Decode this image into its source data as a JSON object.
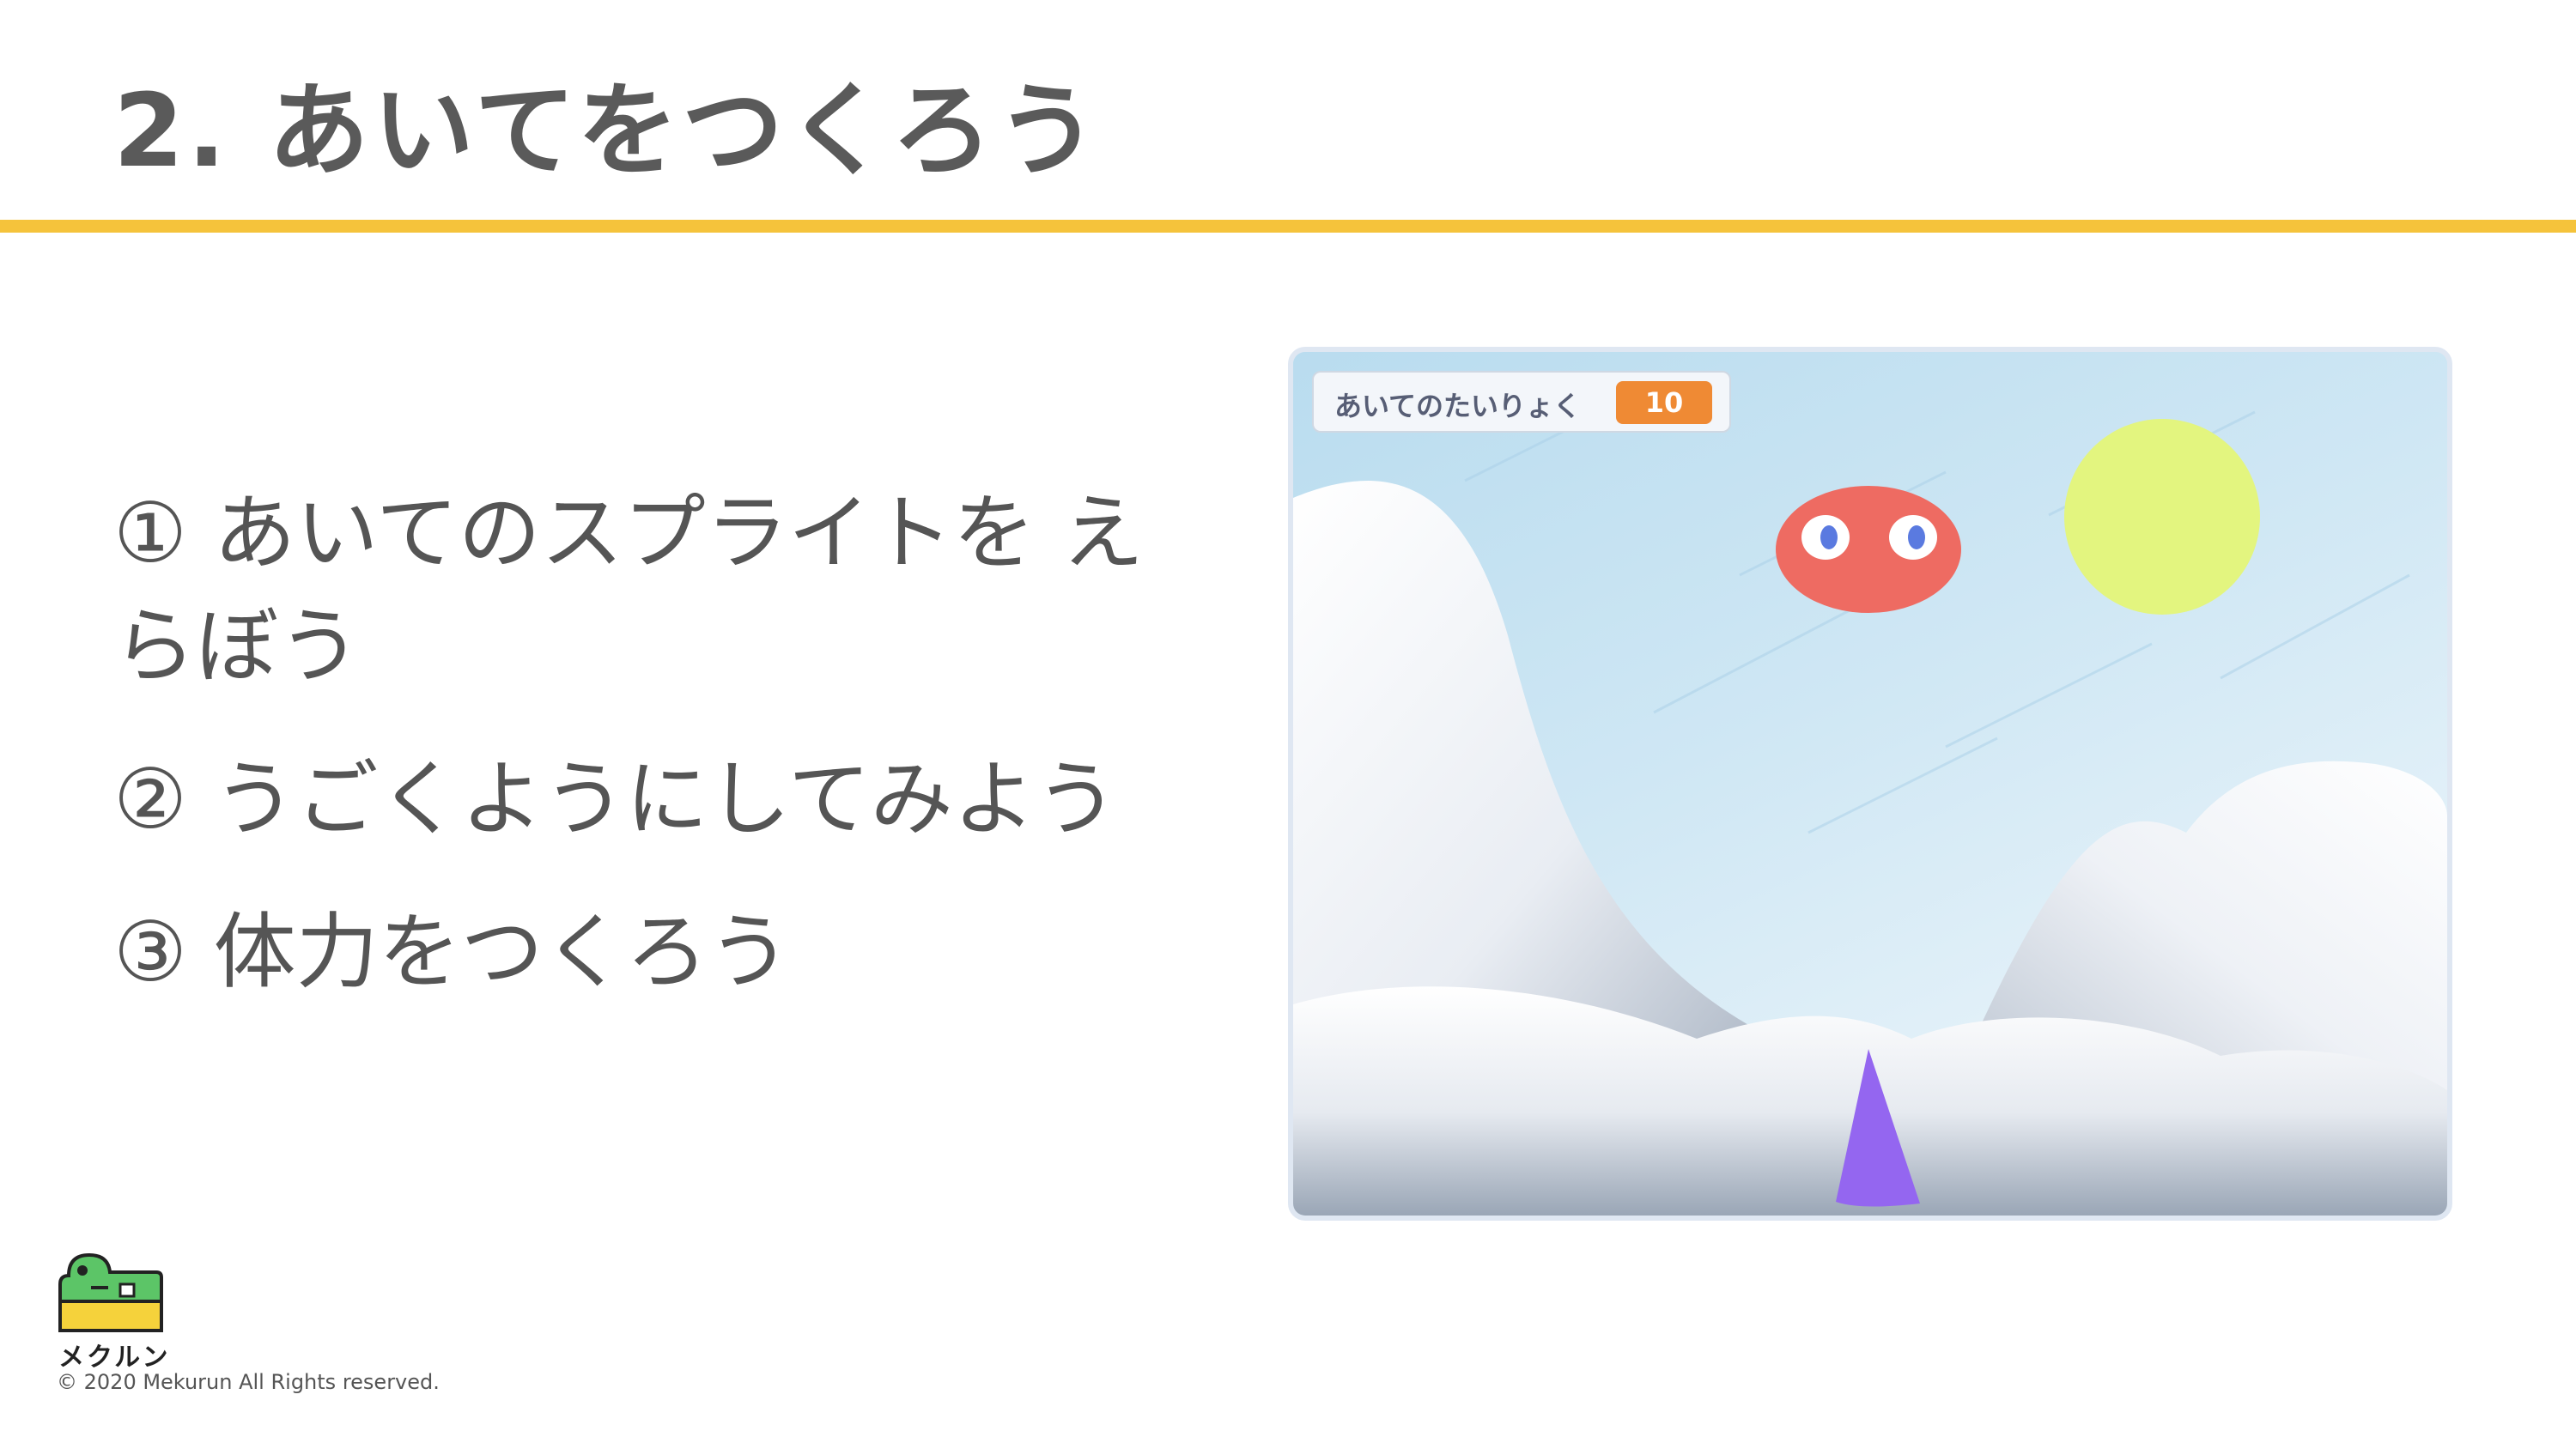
{
  "slide": {
    "title": "2. あいてをつくろう",
    "steps": [
      "① あいてのスプライトを えらぼう",
      "② うごくようにしてみよう",
      "③ 体力をつくろう"
    ]
  },
  "stage": {
    "monitor": {
      "label": "あいてのたいりょく",
      "value": "10"
    }
  },
  "footer": {
    "logo_text": "メクルン",
    "copyright": "© 2020 Mekurun All Rights reserved."
  },
  "colors": {
    "accent_rule": "#f5c33b",
    "monitor_value": "#ef8a34",
    "enemy_sprite": "#ee6b62",
    "sun": "#e3f57f",
    "player_sprite": "#9466f0",
    "logo_green": "#5cc567",
    "logo_yellow": "#f5d23b"
  },
  "icons": {
    "logo": "mekurun-dinosaur-logo"
  }
}
